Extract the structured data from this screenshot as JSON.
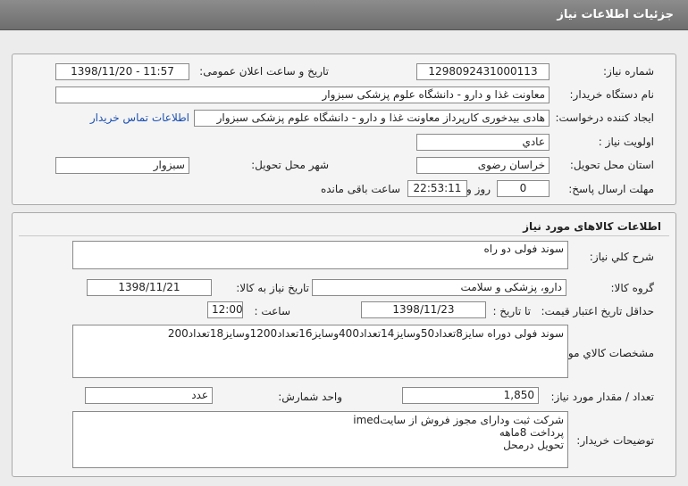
{
  "page_title": "جزئیات اطلاعات نیاز",
  "need_info": {
    "need_number_label": "شماره نیاز:",
    "need_number": "1298092431000113",
    "announce_label": "تاریخ و ساعت اعلان عمومی:",
    "announce_value": "1398/11/20 - 11:57",
    "buyer_org_label": "نام دستگاه خریدار:",
    "buyer_org": "معاونت غذا و دارو - دانشگاه علوم پزشکی سبزوار",
    "creator_label": "ایجاد کننده درخواست:",
    "creator": "هادی بیدخوری کارپرداز معاونت غذا و دارو - دانشگاه علوم پزشکی سبزوار",
    "contact_link": "اطلاعات تماس خریدار",
    "priority_label": "اولویت نیاز :",
    "priority": "عادي",
    "province_label": "استان محل تحویل:",
    "province": "خراسان رضوی",
    "city_label": "شهر محل تحویل:",
    "city": "سبزوار",
    "deadline_label": "مهلت ارسال پاسخ:",
    "deadline_days": "0",
    "days_word": "روز و",
    "deadline_time": "22:53:11",
    "remaining_label": "ساعت باقی مانده"
  },
  "goods": {
    "section_title": "اطلاعات کالاهای مورد نیاز",
    "general_desc_label": "شرح کلي نیاز:",
    "general_desc": "سوند فولی دو راه",
    "group_label": "گروه کالا:",
    "group": "دارو، پزشکی و سلامت",
    "need_date_label": "تاریخ نیاز به کالا:",
    "need_date": "1398/11/21",
    "min_validity_label": "حداقل تاریخ اعتبار قیمت:",
    "until_date_label": "تا تاریخ :",
    "until_date": "1398/11/23",
    "time_label": "ساعت :",
    "time_value": "12:00",
    "spec_label": "مشخصات کالاي مورد نیاز:",
    "spec": "سوند فولی دوراه سایز8تعداد50وسایز14تعداد400وسایز16تعداد1200وسایز18تعداد200",
    "qty_label": "تعداد / مقدار مورد نیاز:",
    "qty": "1,850",
    "unit_label": "واحد شمارش:",
    "unit": "عدد",
    "buyer_notes_label": "توضیحات خریدار:",
    "buyer_notes": "شرکت ثبت ودارای مجوز فروش از سایتimed\nپرداخت 8ماهه\nتحویل درمحل"
  }
}
